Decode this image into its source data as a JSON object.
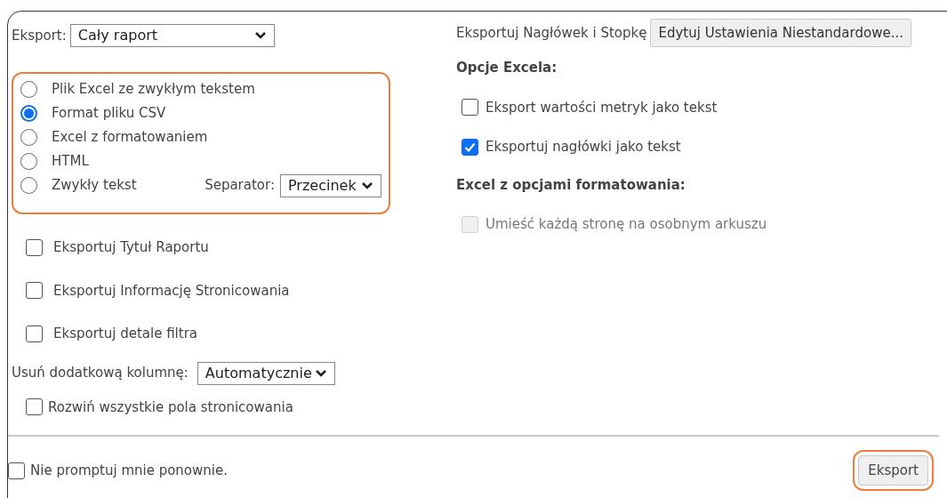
{
  "export_scope": {
    "label": "Eksport:",
    "value": "Cały raport"
  },
  "formats": [
    {
      "label": "Plik Excel ze zwykłym tekstem",
      "selected": false
    },
    {
      "label": "Format pliku CSV",
      "selected": true
    },
    {
      "label": "Excel z formatowaniem",
      "selected": false
    },
    {
      "label": "HTML",
      "selected": false
    },
    {
      "label": "Zwykły tekst",
      "selected": false
    }
  ],
  "separator": {
    "label": "Separator:",
    "value": "Przecinek"
  },
  "left_options": [
    {
      "label": "Eksportuj Tytuł Raportu",
      "checked": false
    },
    {
      "label": "Eksportuj Informację Stronicowania",
      "checked": false
    },
    {
      "label": "Eksportuj detale filtra",
      "checked": false
    }
  ],
  "extra_column": {
    "label": "Usuń dodatkową kolumnę:",
    "value": "Automatycznie"
  },
  "expand_option": {
    "label": "Rozwiń wszystkie pola stronicowania",
    "checked": false
  },
  "header_footer": {
    "label": "Eksportuj Nagłówek i Stopkę",
    "button": "Edytuj Ustawienia Niestandardowe..."
  },
  "excel_options": {
    "title": "Opcje Excela:",
    "items": [
      {
        "label": "Eksport wartości metryk jako tekst",
        "checked": false,
        "disabled": false
      },
      {
        "label": "Eksportuj nagłówki jako tekst",
        "checked": true,
        "disabled": false
      }
    ]
  },
  "formatting_options": {
    "title": "Excel z opcjami formatowania:",
    "items": [
      {
        "label": "Umieść każdą stronę na osobnym arkuszu",
        "checked": false,
        "disabled": true
      }
    ]
  },
  "dont_prompt": {
    "label": "Nie promptuj mnie ponownie.",
    "checked": false
  },
  "export_button": "Eksport"
}
